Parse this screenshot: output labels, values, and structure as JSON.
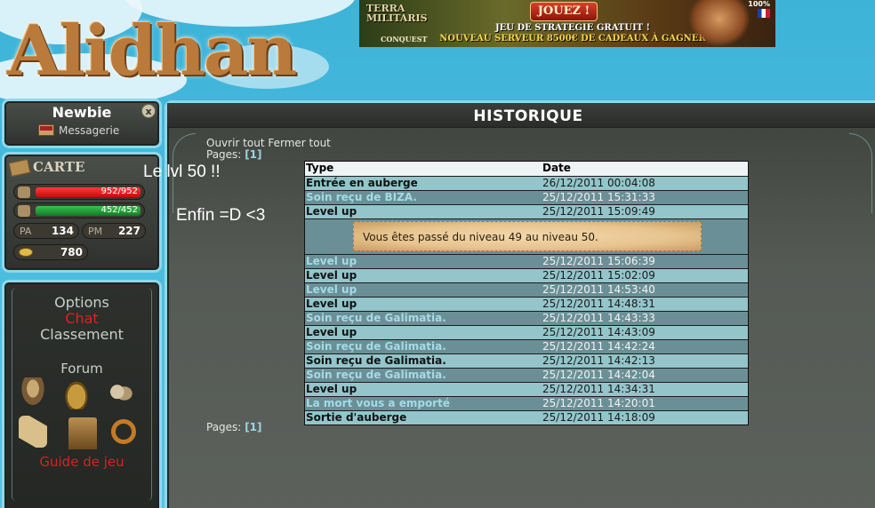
{
  "logo": {
    "text": "Alidhan"
  },
  "banner": {
    "brand_line1": "TERRA",
    "brand_line2": "MILITARIS",
    "brand_sub": "CONQUEST",
    "button": "JOUEZ !",
    "line1": "JEU DE STRATEGIE GRATUIT !",
    "line2": "NOUVEAU SERVEUR 8500€ DE CADEAUX À GAGNER",
    "percent": "100%"
  },
  "user": {
    "name": "Newbie",
    "close": "x",
    "messages_label": "Messagerie"
  },
  "carte": {
    "title": "CARTE",
    "hp": {
      "text": "952/952",
      "fraction": 1.0,
      "color": "#e81a1a"
    },
    "energy": {
      "text": "452/452",
      "fraction": 1.0,
      "color": "#22a03a"
    },
    "pa": {
      "label": "PA",
      "value": "134"
    },
    "pm": {
      "label": "PM",
      "value": "227"
    },
    "gold": {
      "value": "780"
    }
  },
  "menu": {
    "options": "Options",
    "chat": "Chat",
    "classement": "Classement",
    "forum": "Forum",
    "guide": "Guide de jeu",
    "icons": [
      "guard-icon",
      "bag-icon",
      "group-icon",
      "scroll-icon",
      "castle-icon",
      "ring-icon"
    ]
  },
  "notes": {
    "line1": "Le lvl 50 !!",
    "line2": "Enfin =D <3"
  },
  "main": {
    "title": "HISTORIQUE",
    "open_all": "Ouvrir tout",
    "close_all": "Fermer tout",
    "pages_label": "Pages:",
    "page_current": "[1]",
    "columns": {
      "type": "Type",
      "date": "Date"
    },
    "rows_before": [
      {
        "type": "Entrée en auberge",
        "date": "26/12/2011 00:04:08",
        "style": "light"
      },
      {
        "type": "Soin reçu de BIZA.",
        "date": "25/12/2011 15:31:33",
        "style": "dark"
      },
      {
        "type": "Level up",
        "date": "25/12/2011 15:09:49",
        "style": "light"
      }
    ],
    "detail_text": "Vous êtes passé du niveau 49 au niveau 50.",
    "rows_after": [
      {
        "type": "Level up",
        "date": "25/12/2011 15:06:39",
        "style": "dark"
      },
      {
        "type": "Level up",
        "date": "25/12/2011 15:02:09",
        "style": "light"
      },
      {
        "type": "Level up",
        "date": "25/12/2011 14:53:40",
        "style": "dark"
      },
      {
        "type": "Level up",
        "date": "25/12/2011 14:48:31",
        "style": "light"
      },
      {
        "type": "Soin reçu de Galimatia.",
        "date": "25/12/2011 14:43:33",
        "style": "dark"
      },
      {
        "type": "Level up",
        "date": "25/12/2011 14:43:09",
        "style": "light"
      },
      {
        "type": "Soin reçu de Galimatia.",
        "date": "25/12/2011 14:42:24",
        "style": "dark"
      },
      {
        "type": "Soin reçu de Galimatia.",
        "date": "25/12/2011 14:42:13",
        "style": "light"
      },
      {
        "type": "Soin reçu de Galimatia.",
        "date": "25/12/2011 14:42:04",
        "style": "dark"
      },
      {
        "type": "Level up",
        "date": "25/12/2011 14:34:31",
        "style": "light"
      },
      {
        "type": "La mort vous a emporté",
        "date": "25/12/2011 14:20:01",
        "style": "dark"
      },
      {
        "type": "Sortie d'auberge",
        "date": "25/12/2011 14:18:09",
        "style": "light"
      }
    ]
  }
}
